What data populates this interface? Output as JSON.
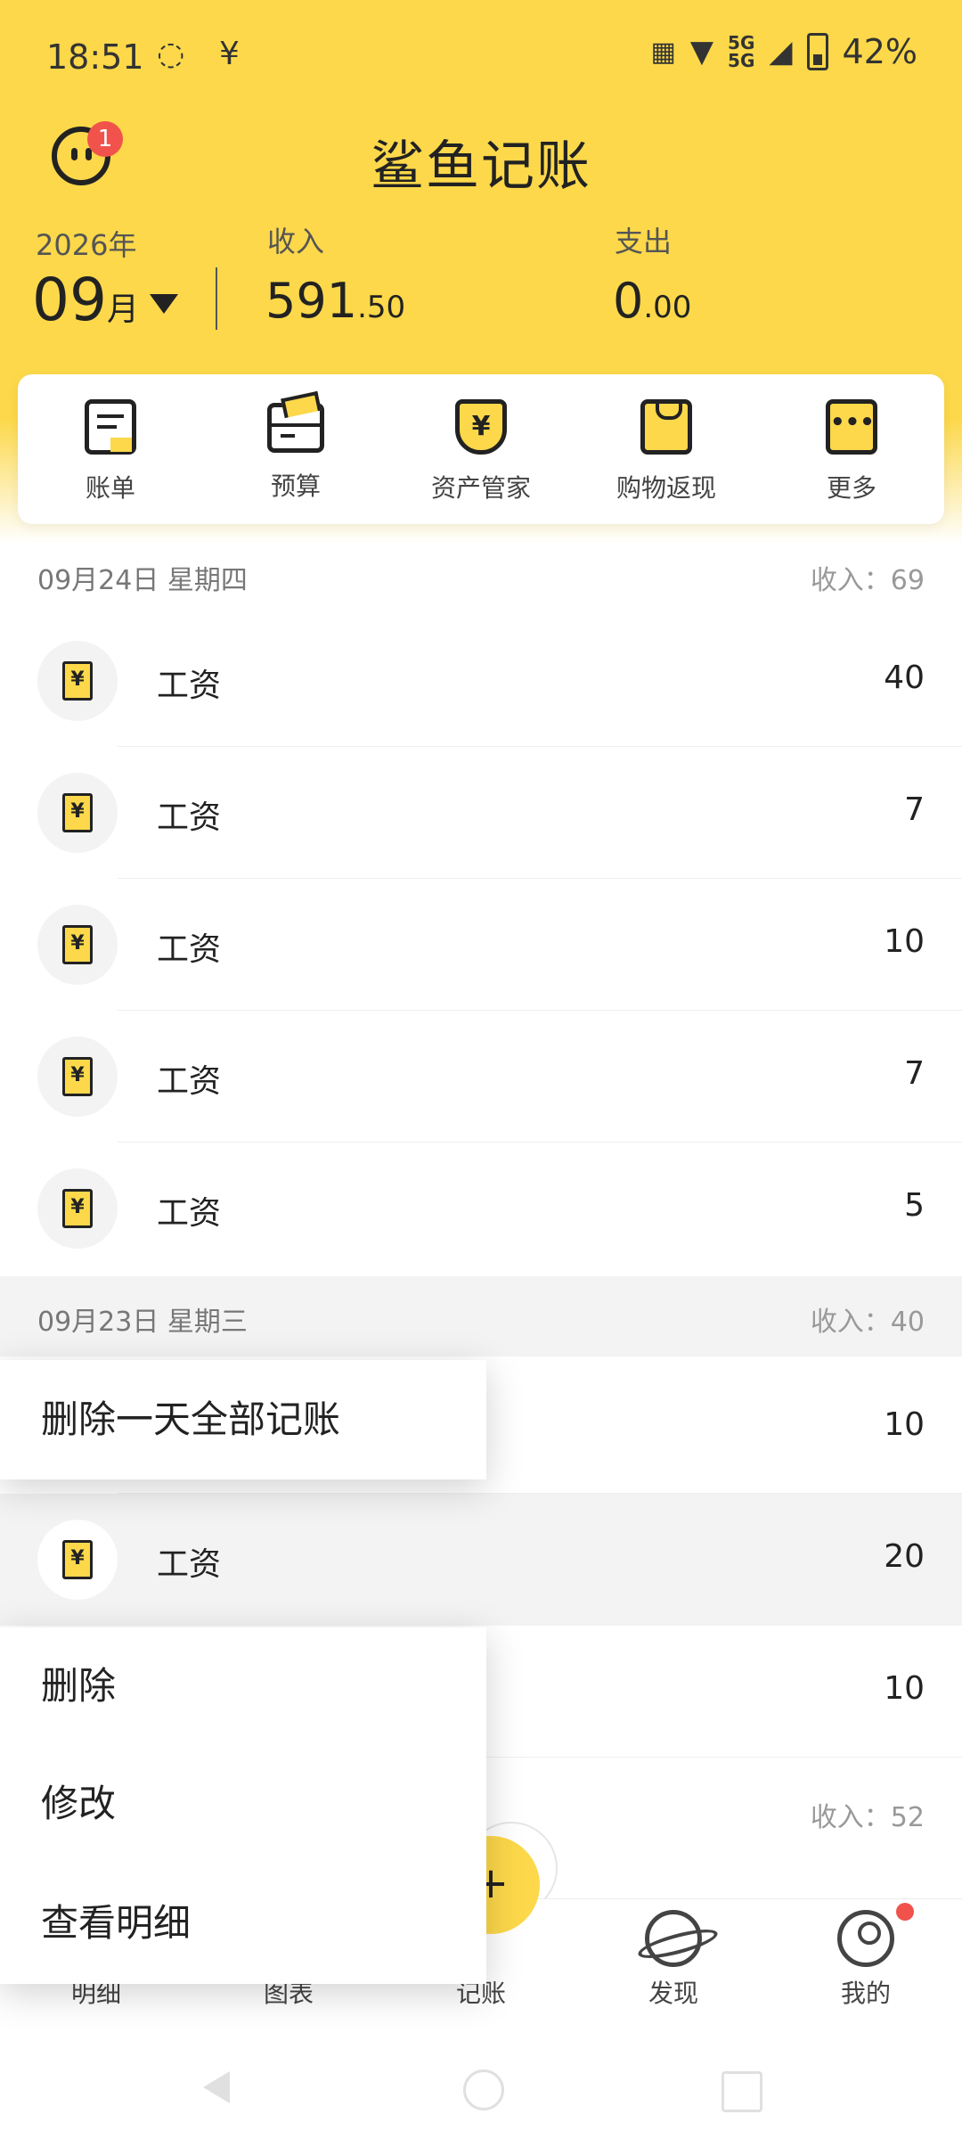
{
  "status_bar": {
    "time": "18:51",
    "left_icons": [
      "sync-circle-icon",
      "yen-icon"
    ],
    "signal": "5G",
    "battery": "42%"
  },
  "header": {
    "title": "鲨鱼记账",
    "notification_count": "1",
    "year": "2026年",
    "month_num": "09",
    "month_unit": "月",
    "income_label": "收入",
    "income_int": "591",
    "income_dec": ".50",
    "expense_label": "支出",
    "expense_int": "0",
    "expense_dec": ".00",
    "accent_color": "#FCD84A"
  },
  "quick_menu": [
    {
      "label": "账单",
      "icon": "bill-icon"
    },
    {
      "label": "预算",
      "icon": "wallet-icon"
    },
    {
      "label": "资产管家",
      "icon": "shield-yen-icon"
    },
    {
      "label": "购物返现",
      "icon": "shopping-bag-icon"
    },
    {
      "label": "更多",
      "icon": "more-icon"
    }
  ],
  "groups": [
    {
      "date": "09月24日 星期四",
      "income": "收入：69",
      "records": [
        {
          "name": "工资",
          "amount": "40"
        },
        {
          "name": "工资",
          "amount": "7"
        },
        {
          "name": "工资",
          "amount": "10"
        },
        {
          "name": "工资",
          "amount": "7"
        },
        {
          "name": "工资",
          "amount": "5"
        }
      ]
    },
    {
      "date": "09月23日 星期三",
      "income": "收入：40",
      "records": [
        {
          "name": "",
          "amount": "10"
        },
        {
          "name": "工资",
          "amount": "20"
        },
        {
          "name": "",
          "amount": "10"
        }
      ]
    },
    {
      "date": "",
      "income": "收入：52",
      "records": []
    }
  ],
  "popup_day": {
    "label": "删除一天全部记账"
  },
  "popup_record": {
    "items": [
      "删除",
      "修改",
      "查看明细"
    ]
  },
  "bottom_nav": [
    {
      "label": "明细"
    },
    {
      "label": "图表"
    },
    {
      "label": "记账"
    },
    {
      "label": "发现"
    },
    {
      "label": "我的"
    }
  ],
  "yen_symbol": "¥"
}
